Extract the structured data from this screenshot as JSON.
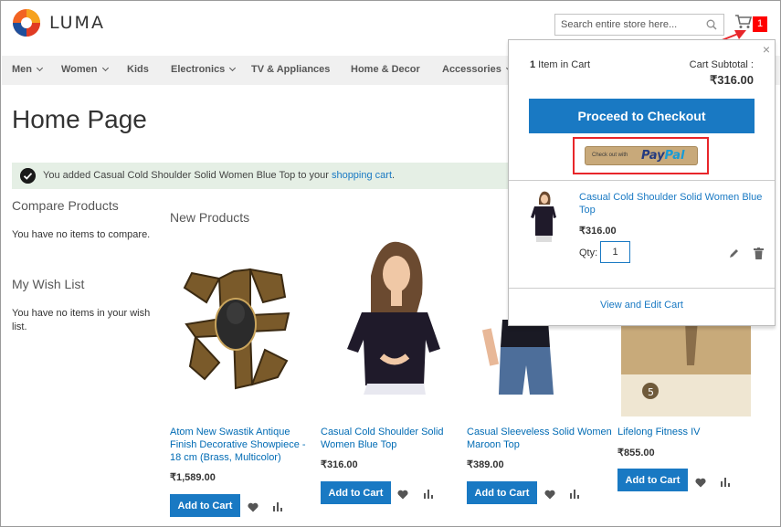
{
  "header": {
    "logo_text": "LUMA",
    "search_placeholder": "Search entire store here...",
    "cart_count": "1"
  },
  "nav": [
    {
      "label": "Men",
      "dropdown": true
    },
    {
      "label": "Women",
      "dropdown": true
    },
    {
      "label": "Kids",
      "dropdown": false
    },
    {
      "label": "Electronics",
      "dropdown": true
    },
    {
      "label": "TV & Appliances",
      "dropdown": false
    },
    {
      "label": "Home & Decor",
      "dropdown": false
    },
    {
      "label": "Accessories",
      "dropdown": true
    }
  ],
  "page_title": "Home Page",
  "message": {
    "text": "You added Casual Cold Shoulder Solid Women Blue Top to your ",
    "link": "shopping cart",
    "suffix": "."
  },
  "sidebar": {
    "compare_title": "Compare Products",
    "compare_empty": "You have no items to compare.",
    "wishlist_title": "My Wish List",
    "wishlist_empty": "You have no items in your wish list."
  },
  "products_section_title": "New Products",
  "products": [
    {
      "name": "Atom New Swastik Antique Finish Decorative Showpiece - 18 cm (Brass, Multicolor)",
      "price": "₹1,589.00",
      "button": "Add to Cart"
    },
    {
      "name": "Casual Cold Shoulder Solid Women Blue Top",
      "price": "₹316.00",
      "button": "Add to Cart"
    },
    {
      "name": "Casual Sleeveless Solid Women Maroon Top",
      "price": "₹389.00",
      "button": "Add to Cart"
    },
    {
      "name": "Lifelong Fitness IV",
      "price": "₹855.00",
      "button": "Add to Cart"
    }
  ],
  "minicart": {
    "close": "×",
    "count_number": "1",
    "count_label": " Item in Cart",
    "subtotal_label": "Cart Subtotal :",
    "subtotal": "₹316.00",
    "checkout": "Proceed to Checkout",
    "paypal_small": "Check out with",
    "paypal_pay": "Pay",
    "paypal_pal": "Pal",
    "item_name": "Casual Cold Shoulder Solid Women Blue Top",
    "item_price": "₹316.00",
    "qty_label": "Qty:",
    "qty_value": "1",
    "view_edit": "View and Edit Cart"
  },
  "colors": {
    "primary": "#1979c3",
    "highlight": "#e8262a",
    "badge": "#ff0000",
    "nav_bg": "#f0f0f0",
    "message_bg": "#e5efe5"
  }
}
